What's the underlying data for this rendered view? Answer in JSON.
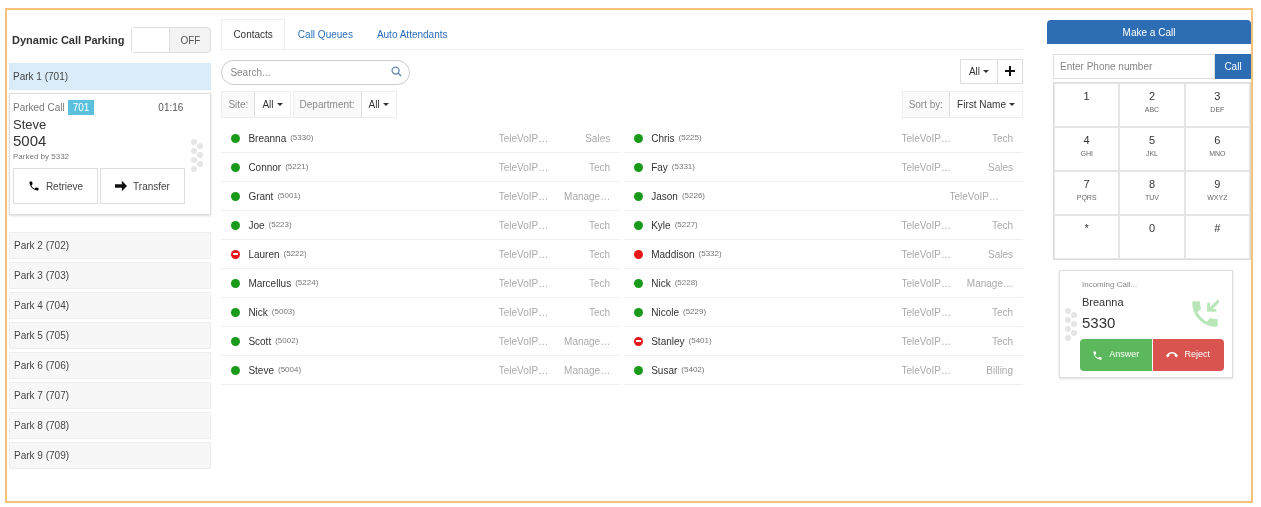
{
  "parking": {
    "title": "Dynamic Call Parking",
    "toggle": {
      "on": false,
      "label": "OFF"
    },
    "parks": [
      {
        "label": "Park 1 (701)",
        "selected": true
      },
      {
        "label": "Park 2 (702)",
        "selected": false
      },
      {
        "label": "Park 3 (703)",
        "selected": false
      },
      {
        "label": "Park 4 (704)",
        "selected": false
      },
      {
        "label": "Park 5 (705)",
        "selected": false
      },
      {
        "label": "Park 6 (706)",
        "selected": false
      },
      {
        "label": "Park 7 (707)",
        "selected": false
      },
      {
        "label": "Park 8 (708)",
        "selected": false
      },
      {
        "label": "Park 9 (709)",
        "selected": false
      }
    ],
    "parked_call": {
      "label": "Parked Call",
      "badge": "701",
      "timer": "01:16",
      "name": "Steve",
      "number": "5004",
      "parked_by": "Parked by 5332",
      "buttons": [
        "Retrieve",
        "Transfer"
      ]
    }
  },
  "tabs": [
    {
      "label": "Contacts",
      "selected": true
    },
    {
      "label": "Call Queues",
      "selected": false
    },
    {
      "label": "Auto Attendants",
      "selected": false
    }
  ],
  "search": {
    "placeholder": "Search..."
  },
  "filter_all": "All",
  "site_filter": {
    "label": "Site:",
    "value": "All"
  },
  "department_filter": {
    "label": "Department:",
    "value": "All"
  },
  "sort": {
    "label": "Sort by:",
    "value": "First Name"
  },
  "contacts": [
    {
      "name": "Breanna",
      "ext": "(5330)",
      "site": "TeleVoIP…",
      "department": "Sales",
      "color": "#1a9a1a",
      "do_not_disturb": false
    },
    {
      "name": "Connor",
      "ext": "(5221)",
      "site": "TeleVoIP…",
      "department": "Tech",
      "color": "#1a9a1a",
      "do_not_disturb": false
    },
    {
      "name": "Grant",
      "ext": "(5001)",
      "site": "TeleVoIP…",
      "department": "Manage…",
      "color": "#1a9a1a",
      "do_not_disturb": false
    },
    {
      "name": "Joe",
      "ext": "(5223)",
      "site": "TeleVoIP…",
      "department": "Tech",
      "color": "#1a9a1a",
      "do_not_disturb": false
    },
    {
      "name": "Lauren",
      "ext": "(5222)",
      "site": "TeleVoIP…",
      "department": "Tech",
      "color": "#e81818",
      "do_not_disturb": true
    },
    {
      "name": "Marcellus",
      "ext": "(5224)",
      "site": "TeleVoIP…",
      "department": "Tech",
      "color": "#1a9a1a",
      "do_not_disturb": false
    },
    {
      "name": "Nick",
      "ext": "(5003)",
      "site": "TeleVoIP…",
      "department": "Tech",
      "color": "#1a9a1a",
      "do_not_disturb": false
    },
    {
      "name": "Scott",
      "ext": "(5002)",
      "site": "TeleVoIP…",
      "department": "Manage…",
      "color": "#1a9a1a",
      "do_not_disturb": false
    },
    {
      "name": "Steve",
      "ext": "(5004)",
      "site": "TeleVoIP…",
      "department": "Manage…",
      "color": "#1a9a1a",
      "do_not_disturb": false
    },
    {
      "name": "Chris",
      "ext": "(5225)",
      "site": "TeleVoIP…",
      "department": "Tech",
      "color": "#1a9a1a",
      "do_not_disturb": false
    },
    {
      "name": "Fay",
      "ext": "(5331)",
      "site": "TeleVoIP…",
      "department": "Sales",
      "color": "#1a9a1a",
      "do_not_disturb": false
    },
    {
      "name": "Jason",
      "ext": "(5226)",
      "site": "TeleVoIP…",
      "color": "#1a9a1a",
      "do_not_disturb": false
    },
    {
      "name": "Kyle",
      "ext": "(5227)",
      "site": "TeleVoIP…",
      "department": "Tech",
      "color": "#1a9a1a",
      "do_not_disturb": false
    },
    {
      "name": "Maddison",
      "ext": "(5332)",
      "site": "TeleVoIP…",
      "department": "Sales",
      "color": "#e81818",
      "do_not_disturb": false
    },
    {
      "name": "Nick",
      "ext": "(5228)",
      "site": "TeleVoIP…",
      "department": "Manage…",
      "color": "#1a9a1a",
      "do_not_disturb": false
    },
    {
      "name": "Nicole",
      "ext": "(5229)",
      "site": "TeleVoIP…",
      "department": "Tech",
      "color": "#1a9a1a",
      "do_not_disturb": false
    },
    {
      "name": "Stanley",
      "ext": "(5401)",
      "site": "TeleVoIP…",
      "department": "Tech",
      "color": "#e81818",
      "do_not_disturb": true
    },
    {
      "name": "Susar",
      "ext": "(5402)",
      "site": "TeleVoIP…",
      "department": "Billing",
      "color": "#1a9a1a",
      "do_not_disturb": false
    }
  ],
  "dialer": {
    "title": "Make a Call",
    "placeholder": "Enter Phone number",
    "call_button": "Call",
    "keys": [
      {
        "digit": "1"
      },
      {
        "digit": "2",
        "letters": "ABC"
      },
      {
        "digit": "3",
        "letters": "DEF"
      },
      {
        "digit": "4",
        "letters": "GHI"
      },
      {
        "digit": "5",
        "letters": "JKL"
      },
      {
        "digit": "6",
        "letters": "MNO"
      },
      {
        "digit": "7",
        "letters": "PQRS"
      },
      {
        "digit": "8",
        "letters": "TUV"
      },
      {
        "digit": "9",
        "letters": "WXYZ"
      },
      {
        "digit": "*"
      },
      {
        "digit": "0"
      },
      {
        "digit": "#"
      }
    ]
  },
  "incoming_call": {
    "label": "Incoming Call...",
    "name": "Breanna",
    "number": "5330",
    "answer": "Answer",
    "reject": "Reject"
  }
}
